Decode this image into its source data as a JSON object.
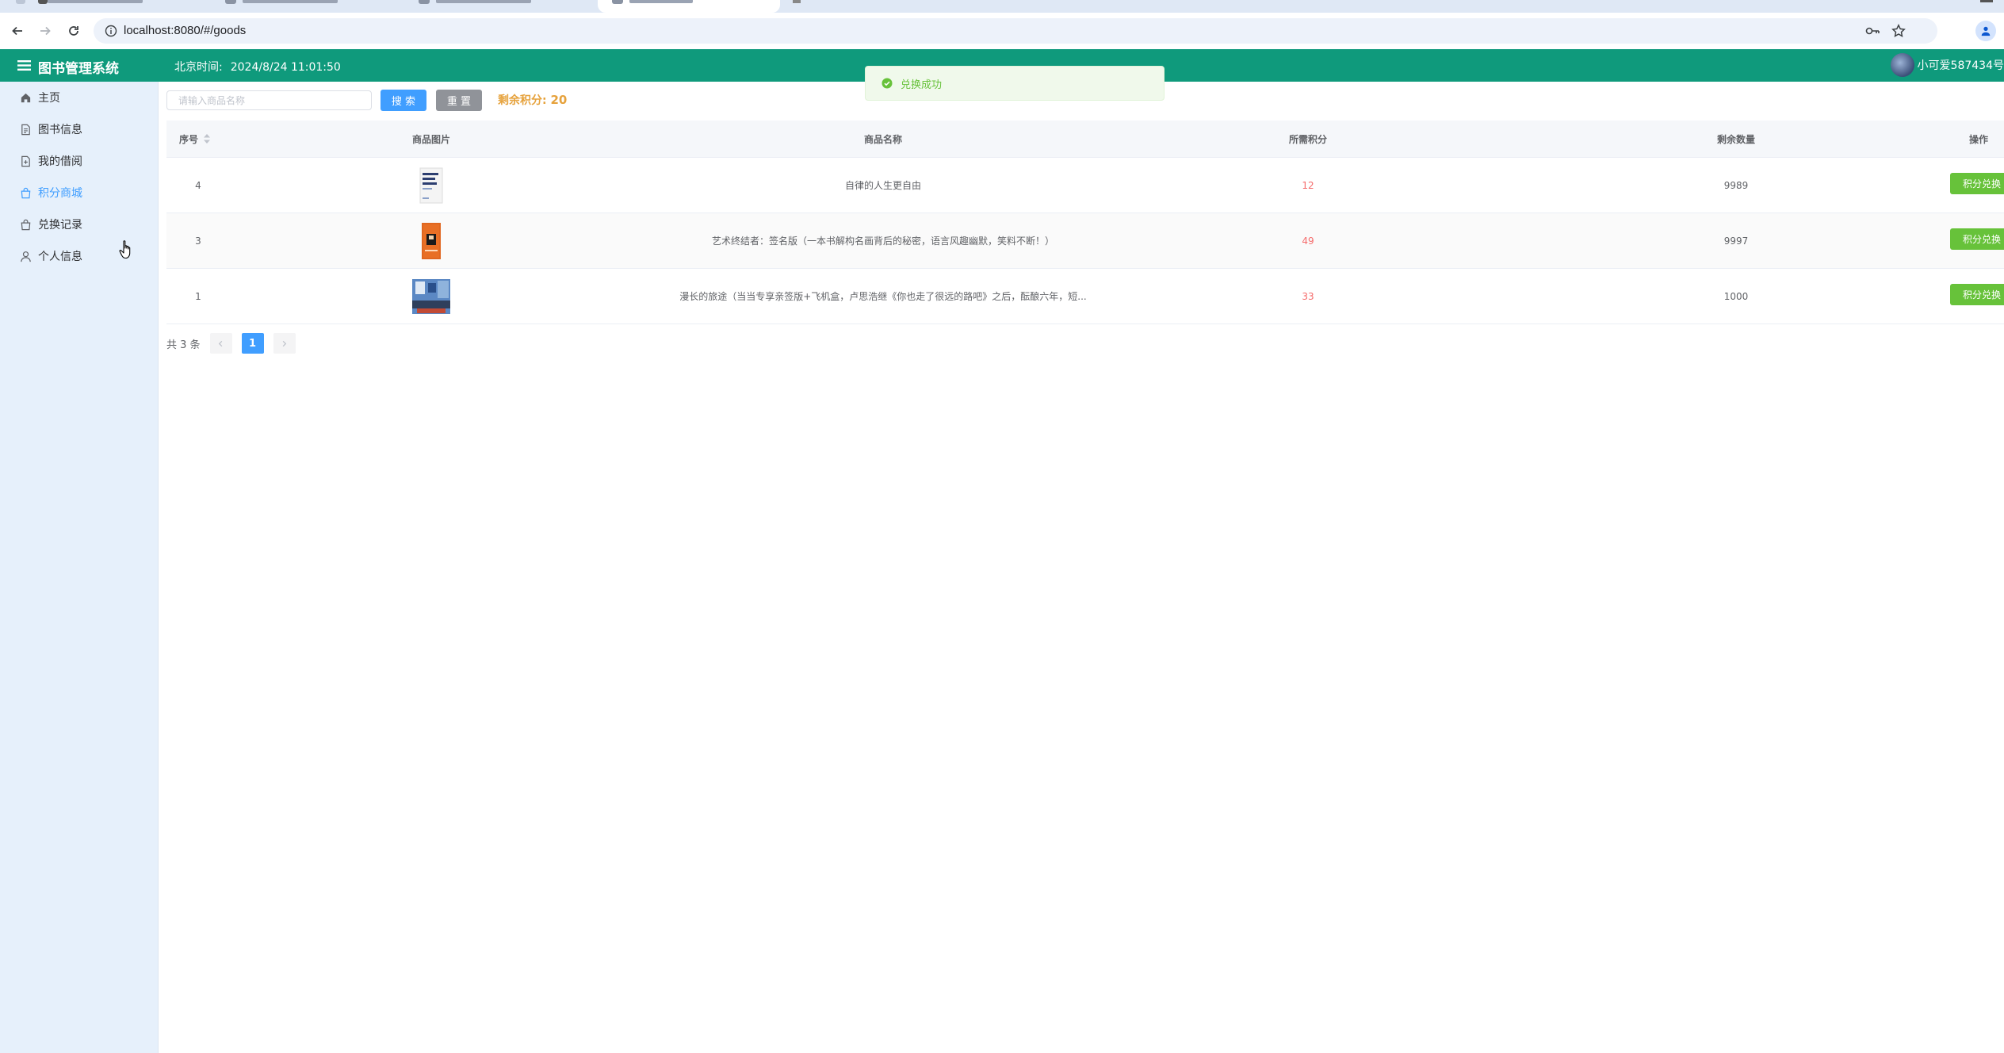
{
  "browser": {
    "url": "localhost:8080/#/goods"
  },
  "app": {
    "title": "图书管理系统",
    "clock_label": "北京时间:",
    "clock_value": "2024/8/24 11:01:50",
    "username": "小可爱587434号"
  },
  "sidebar": {
    "items": [
      {
        "label": "主页",
        "icon": "home-icon"
      },
      {
        "label": "图书信息",
        "icon": "document-icon"
      },
      {
        "label": "我的借阅",
        "icon": "document-add-icon"
      },
      {
        "label": "积分商城",
        "icon": "shopping-bag-icon",
        "active": true
      },
      {
        "label": "兑换记录",
        "icon": "shopping-bag-icon"
      },
      {
        "label": "个人信息",
        "icon": "user-icon"
      }
    ]
  },
  "search": {
    "placeholder": "请输入商品名称",
    "value": "",
    "search_label": "搜 索",
    "reset_label": "重 置"
  },
  "points": {
    "label": "剩余积分:",
    "value": "20"
  },
  "table": {
    "columns": [
      "序号",
      "商品图片",
      "商品名称",
      "所需积分",
      "剩余数量",
      "操作"
    ],
    "rows": [
      {
        "id": "4",
        "name": "自律的人生更自由",
        "points": "12",
        "stock": "9989",
        "action": "积分兑换"
      },
      {
        "id": "3",
        "name": "艺术终结者：签名版（一本书解构名画背后的秘密，语言风趣幽默，笑料不断！）",
        "points": "49",
        "stock": "9997",
        "action": "积分兑换"
      },
      {
        "id": "1",
        "name": "漫长的旅途（当当专享亲签版+飞机盒，卢思浩继《你也走了很远的路吧》之后，酝酿六年，短...",
        "points": "33",
        "stock": "1000",
        "action": "积分兑换"
      }
    ]
  },
  "pagination": {
    "total": "共 3 条",
    "current": "1"
  },
  "toast": {
    "message": "兑换成功"
  },
  "colors": {
    "header_bg": "#0f9a7c",
    "sidebar_bg": "#e6f0fb",
    "primary": "#409eff",
    "success": "#67c23a",
    "warning": "#e6a23c",
    "danger": "#f56c6c"
  }
}
